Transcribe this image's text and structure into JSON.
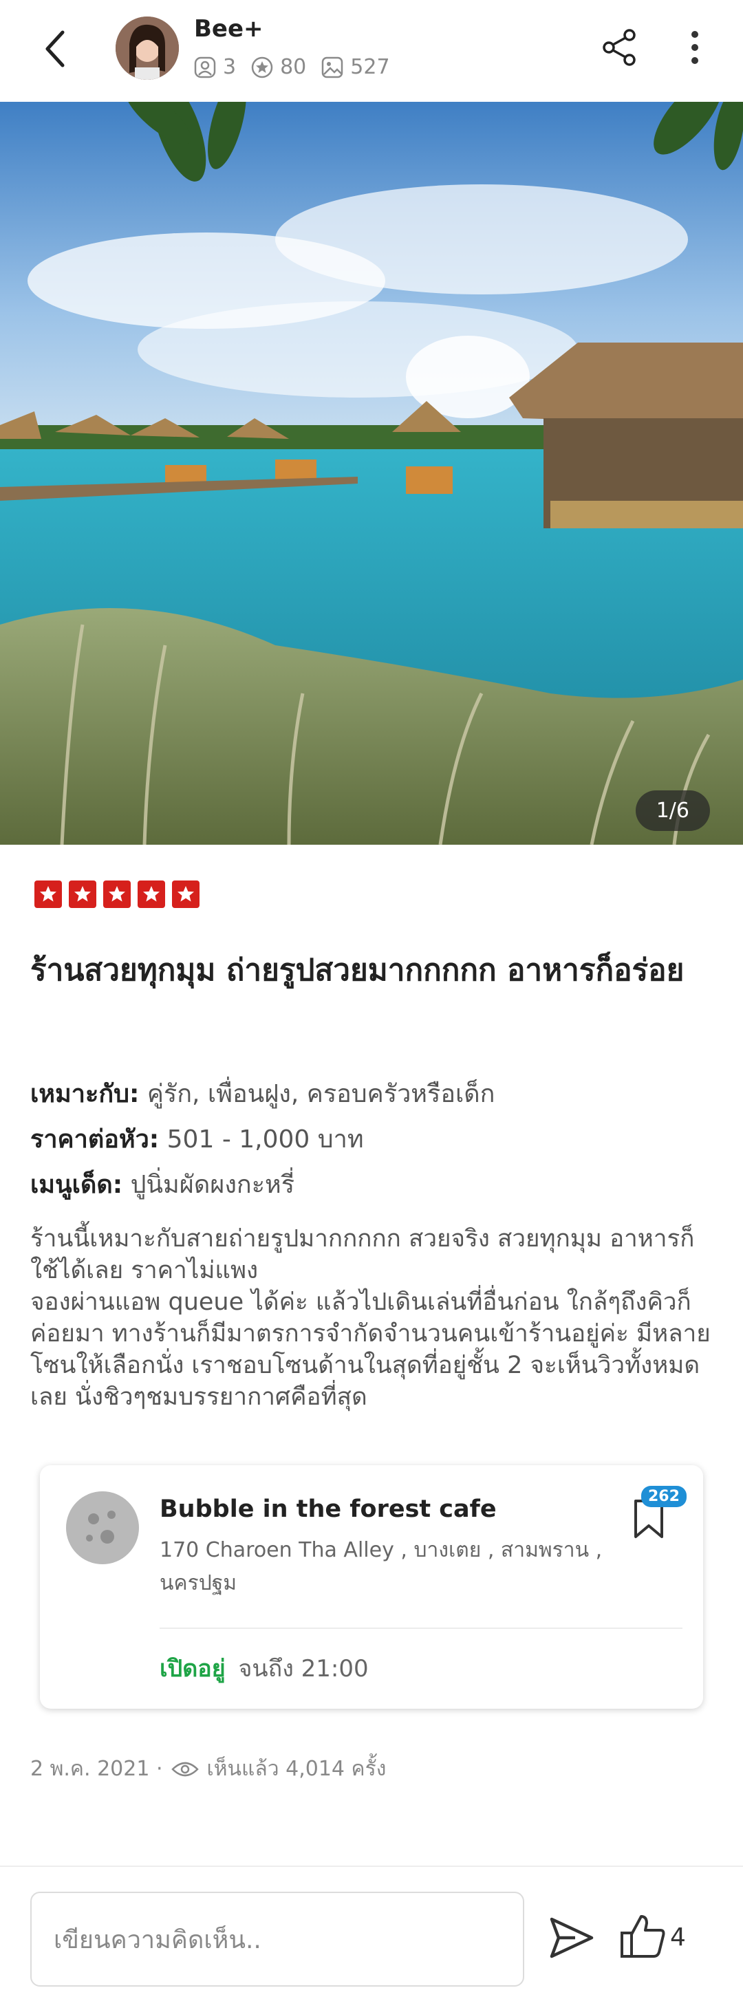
{
  "header": {
    "username": "Bee+",
    "stats": {
      "followers": "3",
      "reviews": "80",
      "photos": "527"
    }
  },
  "photo": {
    "counter": "1/6"
  },
  "review": {
    "rating": 5,
    "title": "ร้านสวยทุกมุม ถ่ายรูปสวยมากกกกก อาหารก็อร่อย",
    "suitable_label": "เหมาะกับ:",
    "suitable_value": "คู่รัก, เพื่อนฝูง, ครอบครัวหรือเด็ก",
    "price_label": "ราคาต่อหัว:",
    "price_value": "501 - 1,000 บาท",
    "menu_label": "เมนูเด็ด:",
    "menu_value": "ปูนิ่มผัดผงกะหรี่",
    "description": "ร้านนี้เหมาะกับสายถ่ายรูปมากกกกก สวยจริง สวยทุกมุม อาหารก็ใช้ได้เลย ราคาไม่แพง\nจองผ่านแอพ queue ได้ค่ะ แล้วไปเดินเล่นที่อื่นก่อน ใกล้ๆถึงคิวก็ค่อยมา ทางร้านก็มีมาตรการจำกัดจำนวนคนเข้าร้านอยู่ค่ะ มีหลายโซนให้เลือกนั่ง เราชอบโซนด้านในสุดที่อยู่ชั้น 2 จะเห็นวิวทั้งหมดเลย นั่งชิวๆชมบรรยากาศคือที่สุด"
  },
  "shop": {
    "name": "Bubble in the forest cafe",
    "address": "170 Charoen Tha Alley , บางเตย , สามพราน , นครปฐม",
    "open_status": "เปิดอยู่",
    "open_until": "จนถึง 21:00",
    "bookmark_count": "262"
  },
  "meta": {
    "date": "2 พ.ค. 2021 ·",
    "views": "เห็นแล้ว 4,014 ครั้ง"
  },
  "footer": {
    "comment_placeholder": "เขียนความคิดเห็น..",
    "like_count": "4"
  },
  "colors": {
    "star": "#d6201c",
    "open": "#1ea446",
    "badge": "#1f8fd6"
  }
}
